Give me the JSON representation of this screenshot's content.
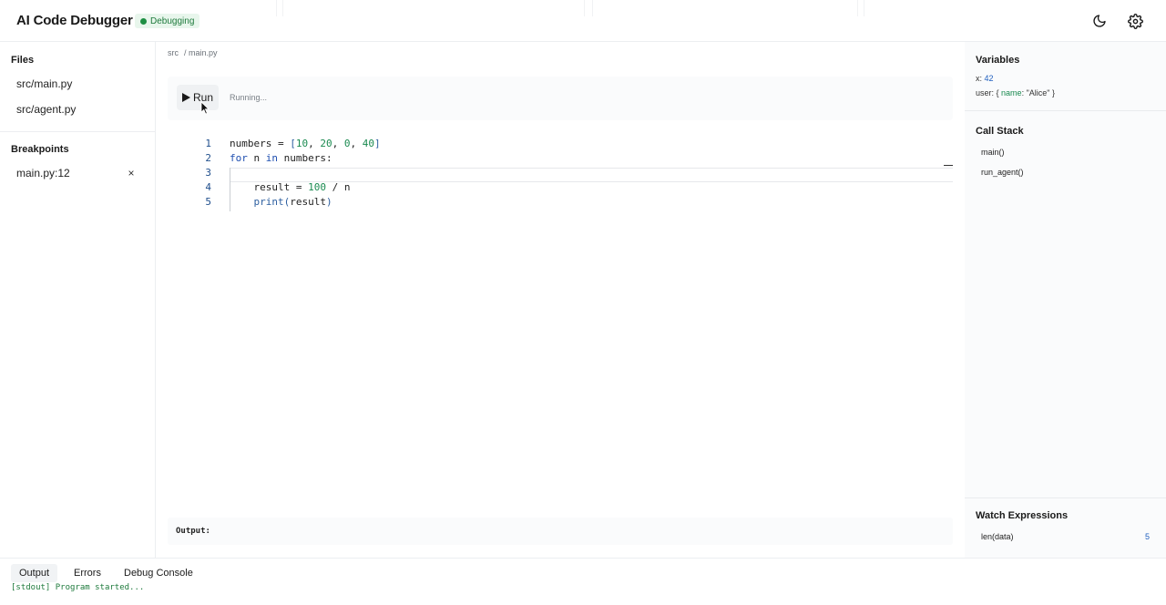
{
  "header": {
    "title": "AI Code Debugger",
    "status": "Debugging",
    "theme_icon": "moon-icon",
    "settings_icon": "gear-icon"
  },
  "sidebar": {
    "files_title": "Files",
    "files": [
      "src/main.py",
      "src/agent.py"
    ],
    "breakpoints_title": "Breakpoints",
    "breakpoints": [
      {
        "label": "main.py:12",
        "remove": "×"
      }
    ]
  },
  "breadcrumb": {
    "root": "src",
    "file": "/ main.py"
  },
  "toolbar": {
    "run_label": "Run",
    "run_icon": "play-icon",
    "status": "Running..."
  },
  "code": {
    "line_numbers": [
      "1",
      "2",
      "3",
      "4",
      "5"
    ],
    "l1": {
      "a": "numbers = ",
      "b": "[",
      "n1": "10",
      "c1": ", ",
      "n2": "20",
      "c2": ", ",
      "n3": "0",
      "c3": ", ",
      "n4": "40",
      "d": "]"
    },
    "l2": {
      "kw1": "for",
      "a": " n ",
      "kw2": "in",
      "b": " numbers:"
    },
    "l4": {
      "a": "    result = ",
      "num": "100",
      "b": " / n"
    },
    "l5": {
      "a": "    ",
      "fn": "print",
      "p1": "(",
      "b": "result",
      "p2": ")"
    }
  },
  "output": {
    "label": "Output:"
  },
  "variables": {
    "title": "Variables",
    "x_key": "x",
    "x_val": "42",
    "user_key": "user",
    "user_open": "{ ",
    "user_name_key": "name",
    "user_name_val": "\"Alice\"",
    "user_close": " }"
  },
  "call_stack": {
    "title": "Call Stack",
    "frames": [
      "main()",
      "run_agent()"
    ]
  },
  "watch": {
    "title": "Watch Expressions",
    "items": [
      {
        "expr": "len(data)",
        "value": "5"
      }
    ]
  },
  "bottom": {
    "tabs": [
      "Output",
      "Errors",
      "Debug Console"
    ],
    "console": "[stdout] Program started..."
  }
}
